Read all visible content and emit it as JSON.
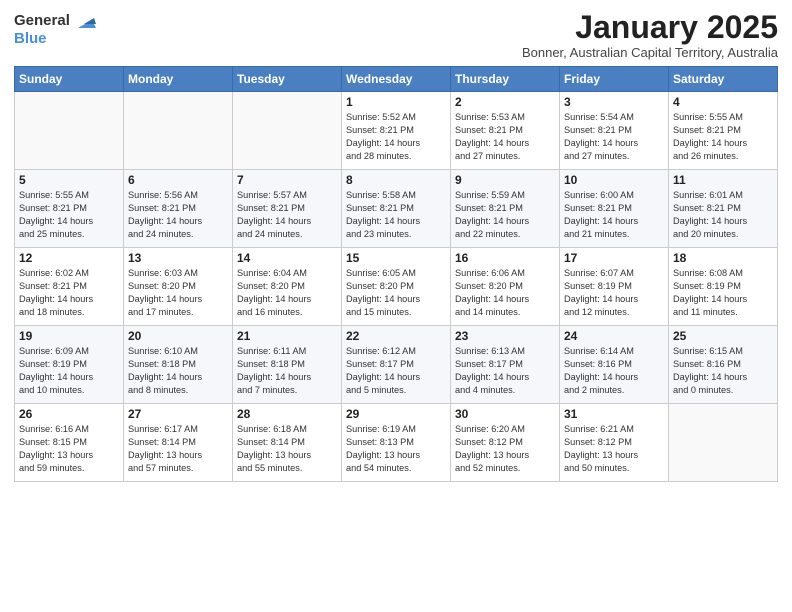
{
  "logo": {
    "general": "General",
    "blue": "Blue"
  },
  "title": "January 2025",
  "subtitle": "Bonner, Australian Capital Territory, Australia",
  "days_of_week": [
    "Sunday",
    "Monday",
    "Tuesday",
    "Wednesday",
    "Thursday",
    "Friday",
    "Saturday"
  ],
  "weeks": [
    [
      {
        "day": "",
        "info": ""
      },
      {
        "day": "",
        "info": ""
      },
      {
        "day": "",
        "info": ""
      },
      {
        "day": "1",
        "info": "Sunrise: 5:52 AM\nSunset: 8:21 PM\nDaylight: 14 hours\nand 28 minutes."
      },
      {
        "day": "2",
        "info": "Sunrise: 5:53 AM\nSunset: 8:21 PM\nDaylight: 14 hours\nand 27 minutes."
      },
      {
        "day": "3",
        "info": "Sunrise: 5:54 AM\nSunset: 8:21 PM\nDaylight: 14 hours\nand 27 minutes."
      },
      {
        "day": "4",
        "info": "Sunrise: 5:55 AM\nSunset: 8:21 PM\nDaylight: 14 hours\nand 26 minutes."
      }
    ],
    [
      {
        "day": "5",
        "info": "Sunrise: 5:55 AM\nSunset: 8:21 PM\nDaylight: 14 hours\nand 25 minutes."
      },
      {
        "day": "6",
        "info": "Sunrise: 5:56 AM\nSunset: 8:21 PM\nDaylight: 14 hours\nand 24 minutes."
      },
      {
        "day": "7",
        "info": "Sunrise: 5:57 AM\nSunset: 8:21 PM\nDaylight: 14 hours\nand 24 minutes."
      },
      {
        "day": "8",
        "info": "Sunrise: 5:58 AM\nSunset: 8:21 PM\nDaylight: 14 hours\nand 23 minutes."
      },
      {
        "day": "9",
        "info": "Sunrise: 5:59 AM\nSunset: 8:21 PM\nDaylight: 14 hours\nand 22 minutes."
      },
      {
        "day": "10",
        "info": "Sunrise: 6:00 AM\nSunset: 8:21 PM\nDaylight: 14 hours\nand 21 minutes."
      },
      {
        "day": "11",
        "info": "Sunrise: 6:01 AM\nSunset: 8:21 PM\nDaylight: 14 hours\nand 20 minutes."
      }
    ],
    [
      {
        "day": "12",
        "info": "Sunrise: 6:02 AM\nSunset: 8:21 PM\nDaylight: 14 hours\nand 18 minutes."
      },
      {
        "day": "13",
        "info": "Sunrise: 6:03 AM\nSunset: 8:20 PM\nDaylight: 14 hours\nand 17 minutes."
      },
      {
        "day": "14",
        "info": "Sunrise: 6:04 AM\nSunset: 8:20 PM\nDaylight: 14 hours\nand 16 minutes."
      },
      {
        "day": "15",
        "info": "Sunrise: 6:05 AM\nSunset: 8:20 PM\nDaylight: 14 hours\nand 15 minutes."
      },
      {
        "day": "16",
        "info": "Sunrise: 6:06 AM\nSunset: 8:20 PM\nDaylight: 14 hours\nand 14 minutes."
      },
      {
        "day": "17",
        "info": "Sunrise: 6:07 AM\nSunset: 8:19 PM\nDaylight: 14 hours\nand 12 minutes."
      },
      {
        "day": "18",
        "info": "Sunrise: 6:08 AM\nSunset: 8:19 PM\nDaylight: 14 hours\nand 11 minutes."
      }
    ],
    [
      {
        "day": "19",
        "info": "Sunrise: 6:09 AM\nSunset: 8:19 PM\nDaylight: 14 hours\nand 10 minutes."
      },
      {
        "day": "20",
        "info": "Sunrise: 6:10 AM\nSunset: 8:18 PM\nDaylight: 14 hours\nand 8 minutes."
      },
      {
        "day": "21",
        "info": "Sunrise: 6:11 AM\nSunset: 8:18 PM\nDaylight: 14 hours\nand 7 minutes."
      },
      {
        "day": "22",
        "info": "Sunrise: 6:12 AM\nSunset: 8:17 PM\nDaylight: 14 hours\nand 5 minutes."
      },
      {
        "day": "23",
        "info": "Sunrise: 6:13 AM\nSunset: 8:17 PM\nDaylight: 14 hours\nand 4 minutes."
      },
      {
        "day": "24",
        "info": "Sunrise: 6:14 AM\nSunset: 8:16 PM\nDaylight: 14 hours\nand 2 minutes."
      },
      {
        "day": "25",
        "info": "Sunrise: 6:15 AM\nSunset: 8:16 PM\nDaylight: 14 hours\nand 0 minutes."
      }
    ],
    [
      {
        "day": "26",
        "info": "Sunrise: 6:16 AM\nSunset: 8:15 PM\nDaylight: 13 hours\nand 59 minutes."
      },
      {
        "day": "27",
        "info": "Sunrise: 6:17 AM\nSunset: 8:14 PM\nDaylight: 13 hours\nand 57 minutes."
      },
      {
        "day": "28",
        "info": "Sunrise: 6:18 AM\nSunset: 8:14 PM\nDaylight: 13 hours\nand 55 minutes."
      },
      {
        "day": "29",
        "info": "Sunrise: 6:19 AM\nSunset: 8:13 PM\nDaylight: 13 hours\nand 54 minutes."
      },
      {
        "day": "30",
        "info": "Sunrise: 6:20 AM\nSunset: 8:12 PM\nDaylight: 13 hours\nand 52 minutes."
      },
      {
        "day": "31",
        "info": "Sunrise: 6:21 AM\nSunset: 8:12 PM\nDaylight: 13 hours\nand 50 minutes."
      },
      {
        "day": "",
        "info": ""
      }
    ]
  ]
}
